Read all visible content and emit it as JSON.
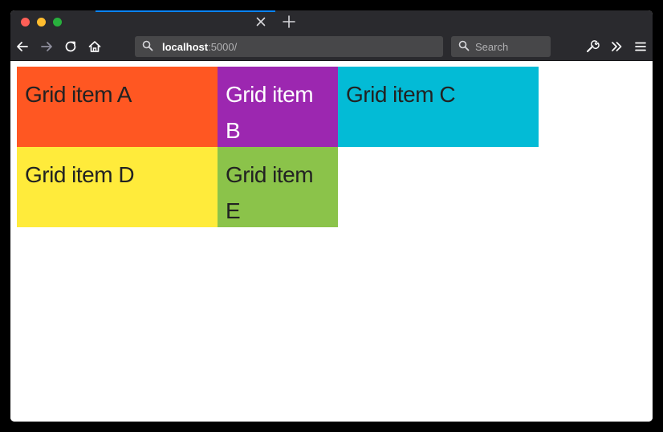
{
  "browser": {
    "url_host": "localhost",
    "url_path": ":5000/",
    "search_placeholder": "Search",
    "colors": {
      "chrome": "#2a2a2e",
      "field": "#474749",
      "tab_accent": "#0a84ff"
    }
  },
  "grid": {
    "items": [
      {
        "label": "Grid item A",
        "color": "#ff5722"
      },
      {
        "label": "Grid item B",
        "color": "#9c27b0"
      },
      {
        "label": "Grid item C",
        "color": "#03bbd6"
      },
      {
        "label": "Grid item D",
        "color": "#ffeb3b"
      },
      {
        "label": "Grid item E",
        "color": "#8bc34a"
      }
    ]
  },
  "icons": {
    "back": "back-arrow-icon",
    "forward": "forward-arrow-icon",
    "reload": "reload-icon",
    "home": "home-icon",
    "url_search": "search-icon",
    "search": "search-icon",
    "tools": "wrench-icon",
    "overflow": "chevron-double-right-icon",
    "menu": "hamburger-menu-icon",
    "tab_close": "close-icon",
    "new_tab": "plus-icon"
  }
}
